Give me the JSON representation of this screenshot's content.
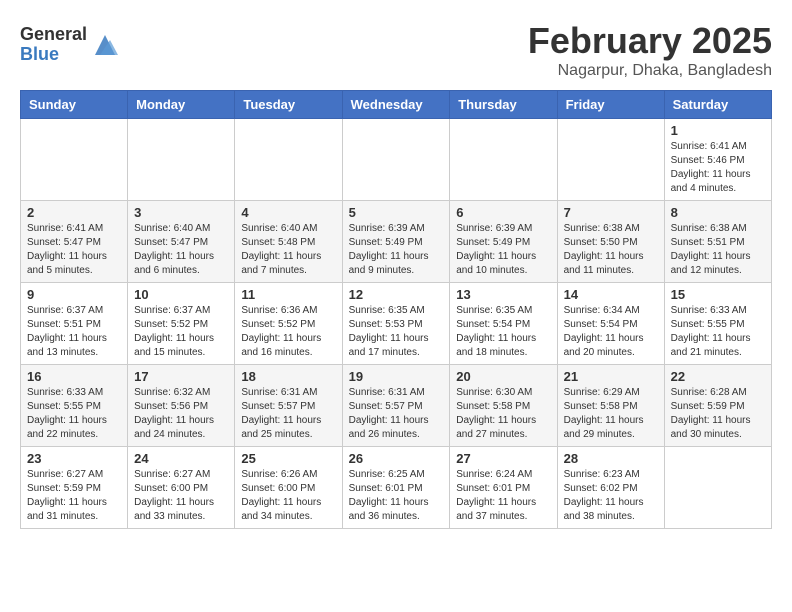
{
  "header": {
    "logo_general": "General",
    "logo_blue": "Blue",
    "month_title": "February 2025",
    "location": "Nagarpur, Dhaka, Bangladesh"
  },
  "weekdays": [
    "Sunday",
    "Monday",
    "Tuesday",
    "Wednesday",
    "Thursday",
    "Friday",
    "Saturday"
  ],
  "weeks": [
    [
      {
        "day": "",
        "info": ""
      },
      {
        "day": "",
        "info": ""
      },
      {
        "day": "",
        "info": ""
      },
      {
        "day": "",
        "info": ""
      },
      {
        "day": "",
        "info": ""
      },
      {
        "day": "",
        "info": ""
      },
      {
        "day": "1",
        "info": "Sunrise: 6:41 AM\nSunset: 5:46 PM\nDaylight: 11 hours and 4 minutes."
      }
    ],
    [
      {
        "day": "2",
        "info": "Sunrise: 6:41 AM\nSunset: 5:47 PM\nDaylight: 11 hours and 5 minutes."
      },
      {
        "day": "3",
        "info": "Sunrise: 6:40 AM\nSunset: 5:47 PM\nDaylight: 11 hours and 6 minutes."
      },
      {
        "day": "4",
        "info": "Sunrise: 6:40 AM\nSunset: 5:48 PM\nDaylight: 11 hours and 7 minutes."
      },
      {
        "day": "5",
        "info": "Sunrise: 6:39 AM\nSunset: 5:49 PM\nDaylight: 11 hours and 9 minutes."
      },
      {
        "day": "6",
        "info": "Sunrise: 6:39 AM\nSunset: 5:49 PM\nDaylight: 11 hours and 10 minutes."
      },
      {
        "day": "7",
        "info": "Sunrise: 6:38 AM\nSunset: 5:50 PM\nDaylight: 11 hours and 11 minutes."
      },
      {
        "day": "8",
        "info": "Sunrise: 6:38 AM\nSunset: 5:51 PM\nDaylight: 11 hours and 12 minutes."
      }
    ],
    [
      {
        "day": "9",
        "info": "Sunrise: 6:37 AM\nSunset: 5:51 PM\nDaylight: 11 hours and 13 minutes."
      },
      {
        "day": "10",
        "info": "Sunrise: 6:37 AM\nSunset: 5:52 PM\nDaylight: 11 hours and 15 minutes."
      },
      {
        "day": "11",
        "info": "Sunrise: 6:36 AM\nSunset: 5:52 PM\nDaylight: 11 hours and 16 minutes."
      },
      {
        "day": "12",
        "info": "Sunrise: 6:35 AM\nSunset: 5:53 PM\nDaylight: 11 hours and 17 minutes."
      },
      {
        "day": "13",
        "info": "Sunrise: 6:35 AM\nSunset: 5:54 PM\nDaylight: 11 hours and 18 minutes."
      },
      {
        "day": "14",
        "info": "Sunrise: 6:34 AM\nSunset: 5:54 PM\nDaylight: 11 hours and 20 minutes."
      },
      {
        "day": "15",
        "info": "Sunrise: 6:33 AM\nSunset: 5:55 PM\nDaylight: 11 hours and 21 minutes."
      }
    ],
    [
      {
        "day": "16",
        "info": "Sunrise: 6:33 AM\nSunset: 5:55 PM\nDaylight: 11 hours and 22 minutes."
      },
      {
        "day": "17",
        "info": "Sunrise: 6:32 AM\nSunset: 5:56 PM\nDaylight: 11 hours and 24 minutes."
      },
      {
        "day": "18",
        "info": "Sunrise: 6:31 AM\nSunset: 5:57 PM\nDaylight: 11 hours and 25 minutes."
      },
      {
        "day": "19",
        "info": "Sunrise: 6:31 AM\nSunset: 5:57 PM\nDaylight: 11 hours and 26 minutes."
      },
      {
        "day": "20",
        "info": "Sunrise: 6:30 AM\nSunset: 5:58 PM\nDaylight: 11 hours and 27 minutes."
      },
      {
        "day": "21",
        "info": "Sunrise: 6:29 AM\nSunset: 5:58 PM\nDaylight: 11 hours and 29 minutes."
      },
      {
        "day": "22",
        "info": "Sunrise: 6:28 AM\nSunset: 5:59 PM\nDaylight: 11 hours and 30 minutes."
      }
    ],
    [
      {
        "day": "23",
        "info": "Sunrise: 6:27 AM\nSunset: 5:59 PM\nDaylight: 11 hours and 31 minutes."
      },
      {
        "day": "24",
        "info": "Sunrise: 6:27 AM\nSunset: 6:00 PM\nDaylight: 11 hours and 33 minutes."
      },
      {
        "day": "25",
        "info": "Sunrise: 6:26 AM\nSunset: 6:00 PM\nDaylight: 11 hours and 34 minutes."
      },
      {
        "day": "26",
        "info": "Sunrise: 6:25 AM\nSunset: 6:01 PM\nDaylight: 11 hours and 36 minutes."
      },
      {
        "day": "27",
        "info": "Sunrise: 6:24 AM\nSunset: 6:01 PM\nDaylight: 11 hours and 37 minutes."
      },
      {
        "day": "28",
        "info": "Sunrise: 6:23 AM\nSunset: 6:02 PM\nDaylight: 11 hours and 38 minutes."
      },
      {
        "day": "",
        "info": ""
      }
    ]
  ]
}
